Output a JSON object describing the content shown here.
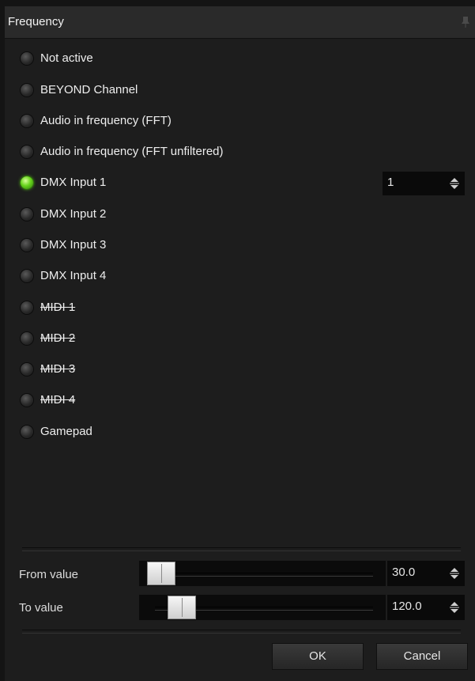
{
  "window": {
    "title": "Frequency",
    "pin_icon": "pin-icon"
  },
  "sources": [
    {
      "label": "Not active",
      "selected": false,
      "strikethrough": false
    },
    {
      "label": "BEYOND Channel",
      "selected": false,
      "strikethrough": false
    },
    {
      "label": "Audio in frequency (FFT)",
      "selected": false,
      "strikethrough": false
    },
    {
      "label": "Audio in frequency (FFT unfiltered)",
      "selected": false,
      "strikethrough": false
    },
    {
      "label": "DMX Input 1",
      "selected": true,
      "strikethrough": false
    },
    {
      "label": "DMX Input 2",
      "selected": false,
      "strikethrough": false
    },
    {
      "label": "DMX Input 3",
      "selected": false,
      "strikethrough": false
    },
    {
      "label": "DMX Input 4",
      "selected": false,
      "strikethrough": false
    },
    {
      "label": "MIDI 1",
      "selected": false,
      "strikethrough": true
    },
    {
      "label": "MIDI 2",
      "selected": false,
      "strikethrough": true
    },
    {
      "label": "MIDI 3",
      "selected": false,
      "strikethrough": true
    },
    {
      "label": "MIDI 4",
      "selected": false,
      "strikethrough": true
    },
    {
      "label": "Gamepad",
      "selected": false,
      "strikethrough": false
    }
  ],
  "dmx_channel": {
    "value": "1"
  },
  "from_value": {
    "label": "From value",
    "value": "30.0",
    "slider_fraction": 0.0
  },
  "to_value": {
    "label": "To value",
    "value": "120.0",
    "slider_fraction": 0.1
  },
  "buttons": {
    "ok": "OK",
    "cancel": "Cancel"
  },
  "colors": {
    "selected_led": "#67d41c",
    "background": "#1d1d1d"
  }
}
